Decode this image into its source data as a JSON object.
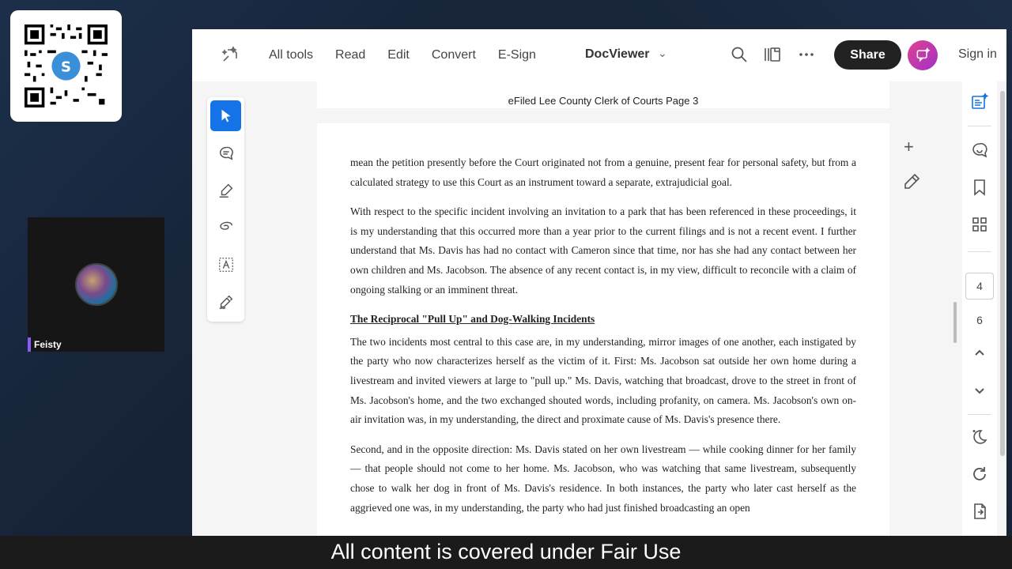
{
  "toolbar": {
    "nav_items": [
      "All tools",
      "Read",
      "Edit",
      "Convert",
      "E-Sign"
    ],
    "doc_title": "DocViewer",
    "share_label": "Share",
    "signin_label": "Sign in"
  },
  "participant": {
    "name": "Feisty"
  },
  "document": {
    "page_header": "eFiled Lee County Clerk of Courts Page 3",
    "paragraphs": [
      "mean the petition presently before the Court originated not from a genuine, present fear for personal safety, but from a calculated strategy to use this Court as an instrument toward a separate, extrajudicial goal.",
      "With respect to the specific incident involving an invitation to a park that has been referenced in these proceedings, it is my understanding that this occurred more than a year prior to the current filings and is not a recent event. I further understand that Ms. Davis has had no contact with Cameron since that time, nor has she had any contact between her own children and Ms. Jacobson. The absence of any recent contact is, in my view, difficult to reconcile with a claim of ongoing stalking or an imminent threat.",
      "The two incidents most central to this case are, in my understanding, mirror images of one another, each instigated by the party who now characterizes herself as the victim of it. First: Ms. Jacobson sat outside her own home during a livestream and invited viewers at large to \"pull up.\" Ms. Davis, watching that broadcast, drove to the street in front of Ms. Jacobson's home, and the two exchanged shouted words, including profanity, on camera. Ms. Jacobson's own on-air invitation was, in my understanding, the direct and proximate cause of Ms. Davis's presence there.",
      "Second, and in the opposite direction: Ms. Davis stated on her own livestream — while cooking dinner for her family — that people should not come to her home. Ms. Jacobson, who was watching that same livestream, subsequently chose to walk her dog in front of Ms. Davis's residence. In both instances, the party who later cast herself as the aggrieved one was, in my understanding, the party who had just finished broadcasting an open"
    ],
    "heading": "The Reciprocal \"Pull Up\" and Dog-Walking Incidents"
  },
  "pager": {
    "current_page": "4",
    "total_pages": "6"
  },
  "caption": "All content is covered under Fair Use",
  "colors": {
    "accent": "#1473e6",
    "share_bg": "#222222",
    "badge": "#c83aa8",
    "name_tag": "#8b5cf6"
  }
}
